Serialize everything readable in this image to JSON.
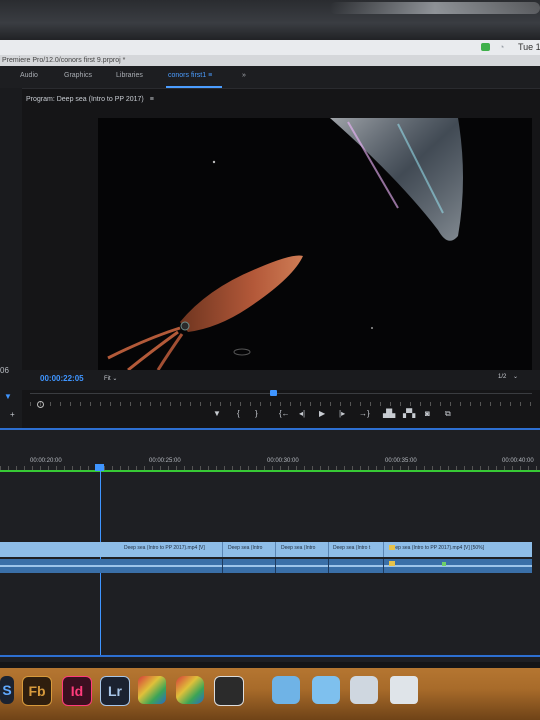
{
  "menubar": {
    "clock": "Tue 1"
  },
  "window": {
    "title": "Premiere Pro/12.0/conors first 9.prproj *"
  },
  "workspace_tabs": [
    {
      "label": "Audio"
    },
    {
      "label": "Graphics"
    },
    {
      "label": "Libraries"
    },
    {
      "label": "conors first1",
      "active": true
    },
    {
      "label": "»"
    }
  ],
  "program_monitor": {
    "title": "Program: Deep sea (Intro to PP 2017)",
    "menu_glyph": "≡",
    "timecode": "00:00:22:05",
    "left_timecode": "06",
    "fit": "Fit",
    "resolution": "1/2"
  },
  "timeline": {
    "ruler_labels": [
      "00:00:20:00",
      "00:00:25:00",
      "00:00:30:00",
      "00:00:35:00",
      "00:00:40:00"
    ],
    "clips": [
      {
        "label": "Deep sea (Intro to PP 2017).mp4 [V]"
      },
      {
        "label": "Deep sea (Intro"
      },
      {
        "label": "Deep sea (Intro"
      },
      {
        "label": "Deep sea (Intro t"
      },
      {
        "label": "Deep sea (Intro to PP 2017).mp4 [V] [50%]"
      }
    ]
  },
  "dock": {
    "apps": [
      {
        "label": "S",
        "icon": "photoshop-icon"
      },
      {
        "label": "Fb",
        "icon": "flash-builder-icon"
      },
      {
        "label": "Id",
        "icon": "indesign-icon"
      },
      {
        "label": "Lr",
        "icon": "lightroom-icon"
      }
    ]
  }
}
